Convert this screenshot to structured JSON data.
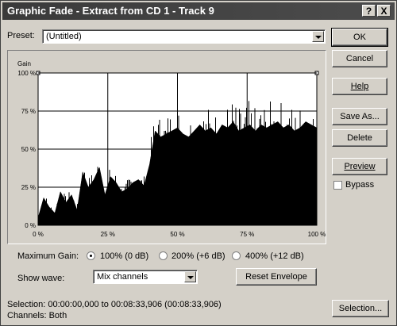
{
  "window": {
    "title": "Graphic Fade - Extract from CD 1 - Track 9",
    "help_glyph": "?",
    "close_glyph": "X"
  },
  "preset": {
    "label": "Preset:",
    "value": "(Untitled)"
  },
  "buttons": {
    "ok": "OK",
    "cancel": "Cancel",
    "help": "Help",
    "save_as": "Save As...",
    "delete": "Delete",
    "preview": "Preview",
    "reset_envelope": "Reset Envelope",
    "selection": "Selection..."
  },
  "bypass": {
    "label": "Bypass",
    "checked": false
  },
  "graph": {
    "gain_label": "Gain",
    "y_ticks": [
      "100 %",
      "75 %",
      "50 %",
      "25 %",
      "0 %"
    ],
    "x_ticks": [
      "0 %",
      "25 %",
      "50 %",
      "75 %",
      "100 %"
    ]
  },
  "max_gain": {
    "label": "Maximum Gain:",
    "options": [
      "100% (0 dB)",
      "200% (+6 dB)",
      "400% (+12 dB)"
    ],
    "selected": 0
  },
  "show_wave": {
    "label": "Show wave:",
    "value": "Mix channels"
  },
  "info": {
    "selection": "Selection:  00:00:00,000 to 00:08:33,906 (00:08:33,906)",
    "channels": "Channels:  Both"
  },
  "colors": {
    "titlebar": "#3a3a3a",
    "face": "#d4d0c8",
    "waveform": "#000000",
    "graph_bg": "#ffffff"
  },
  "chart_data": {
    "type": "area",
    "description": "waveform amplitude envelope (approx. % of full scale) across selection position",
    "x": [
      0,
      2,
      4,
      6,
      8,
      10,
      12,
      14,
      16,
      18,
      20,
      22,
      24,
      26,
      28,
      30,
      32,
      34,
      36,
      38,
      40,
      42,
      44,
      46,
      48,
      50,
      52,
      54,
      56,
      58,
      60,
      62,
      64,
      66,
      68,
      70,
      72,
      74,
      76,
      78,
      80,
      82,
      84,
      86,
      88,
      90,
      92,
      94,
      96,
      98,
      100
    ],
    "y": [
      5,
      18,
      12,
      8,
      22,
      15,
      20,
      10,
      35,
      25,
      30,
      38,
      20,
      32,
      28,
      22,
      24,
      28,
      30,
      26,
      40,
      62,
      58,
      60,
      62,
      64,
      60,
      58,
      62,
      66,
      62,
      64,
      60,
      66,
      64,
      68,
      62,
      64,
      66,
      62,
      66,
      64,
      66,
      68,
      64,
      66,
      62,
      64,
      68,
      66,
      64
    ],
    "xlim": [
      0,
      100
    ],
    "ylim": [
      0,
      100
    ],
    "grid": true
  }
}
